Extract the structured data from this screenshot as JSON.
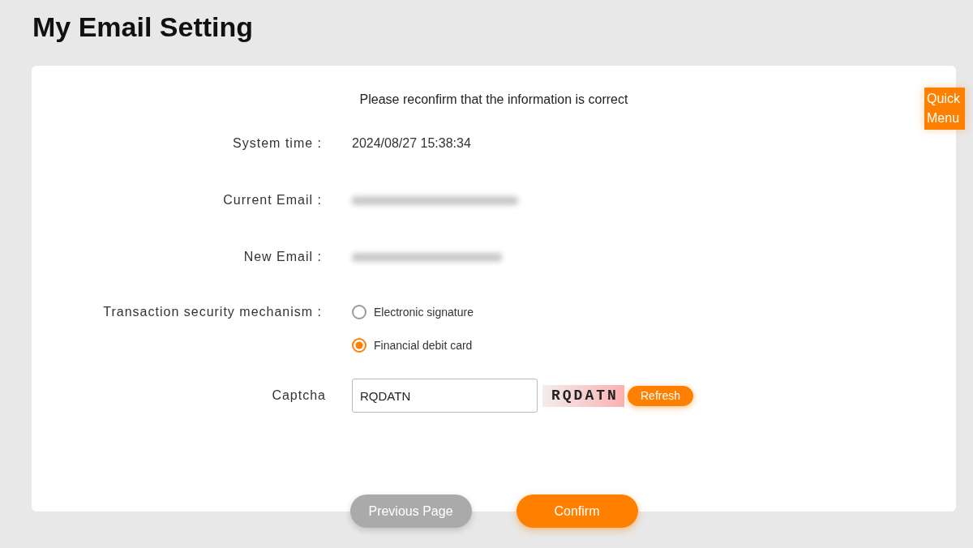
{
  "page": {
    "title": "My Email Setting"
  },
  "quick_menu": {
    "label": "Quick Menu"
  },
  "form": {
    "heading": "Please reconfirm that the information is correct",
    "fields": [
      {
        "kind": "text",
        "label": "System time :",
        "value": "2024/08/27 15:38:34"
      },
      {
        "kind": "blurred",
        "label": "Current Email :"
      },
      {
        "kind": "blurred",
        "label": "New Email :"
      },
      {
        "kind": "radio",
        "label": "Transaction security mechanism :",
        "options": [
          {
            "label": "Electronic signature",
            "selected": false
          },
          {
            "label": "Financial debit card",
            "selected": true
          }
        ]
      },
      {
        "kind": "captcha",
        "label": "Captcha",
        "value": "RQDATN",
        "captcha_image_text": "RQDATN",
        "refresh_button": "Refresh"
      }
    ]
  },
  "buttons": [
    {
      "kind": "secondary",
      "label": "Previous Page"
    },
    {
      "kind": "primary",
      "label": "Confirm"
    }
  ]
}
